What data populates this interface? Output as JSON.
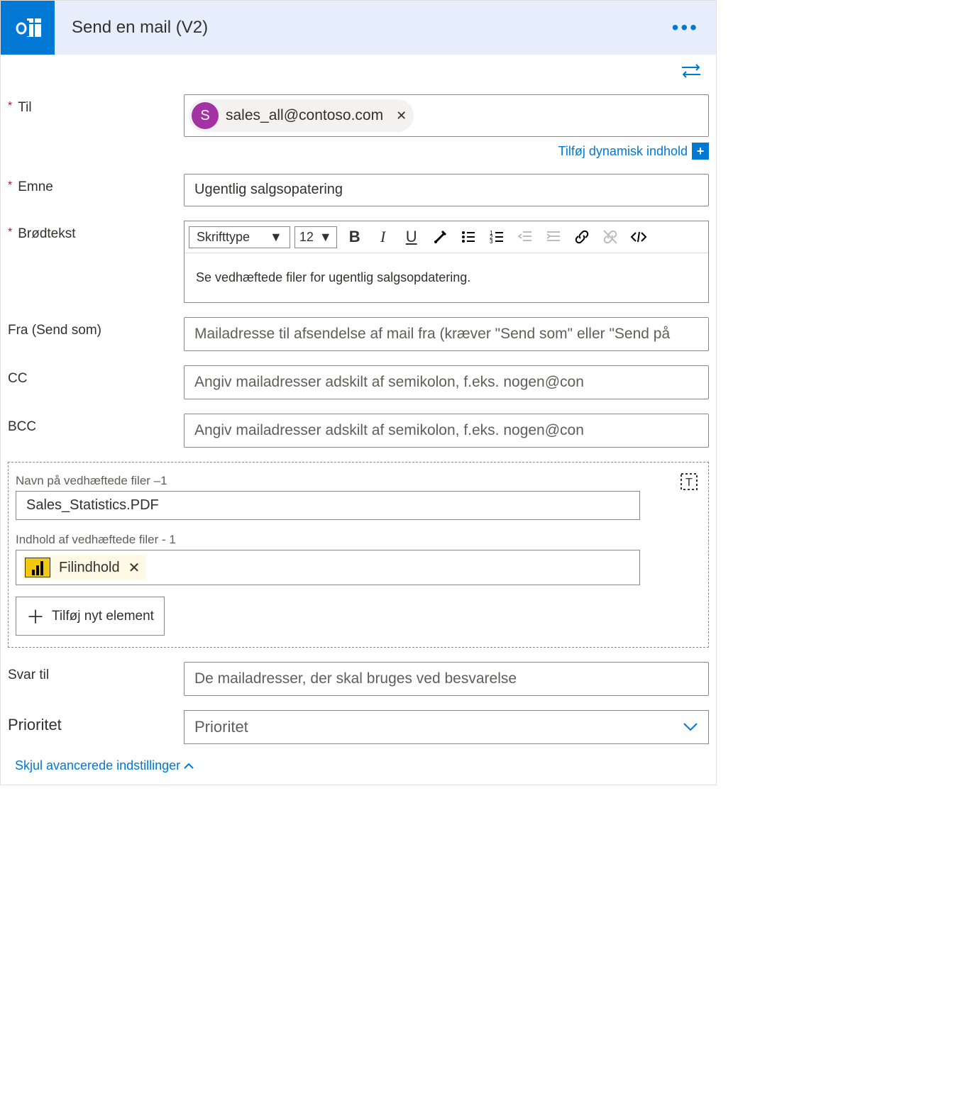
{
  "header": {
    "title": "Send en mail (V2)"
  },
  "labels": {
    "to": "Til",
    "subject": "Emne",
    "body": "Brødtekst",
    "from": "Fra (Send som)",
    "cc": "CC",
    "bcc": "BCC",
    "reply_to": "Svar til",
    "priority": "Prioritet"
  },
  "fields": {
    "to_chip_initial": "S",
    "to_chip_text": "sales_all@contoso.com",
    "subject_value": "Ugentlig salgsopatering",
    "body_value": "Se vedhæftede filer for ugentlig salgsopdatering.",
    "from_placeholder": "Mailadresse til afsendelse af mail fra (kræver \"Send som\" eller \"Send på",
    "cc_placeholder": "Angiv mailadresser adskilt af semikolon, f.eks. nogen@con",
    "bcc_placeholder": "Angiv mailadresser adskilt af semikolon, f.eks. nogen@con",
    "reply_to_placeholder": "De mailadresser, der skal bruges ved besvarelse",
    "priority_placeholder": "Prioritet"
  },
  "dynamic_content": {
    "label": "Tilføj dynamisk indhold"
  },
  "rte": {
    "font_label": "Skrifttype",
    "size_label": "12"
  },
  "attachments": {
    "name_label": "Navn på vedhæftede filer –1",
    "name_value": "Sales_Statistics.PDF",
    "content_label": "Indhold af vedhæftede filer  - 1",
    "token_text": "Filindhold",
    "add_button": "Tilføj nyt element"
  },
  "footer": {
    "hide_advanced": "Skjul avancerede indstillinger"
  }
}
